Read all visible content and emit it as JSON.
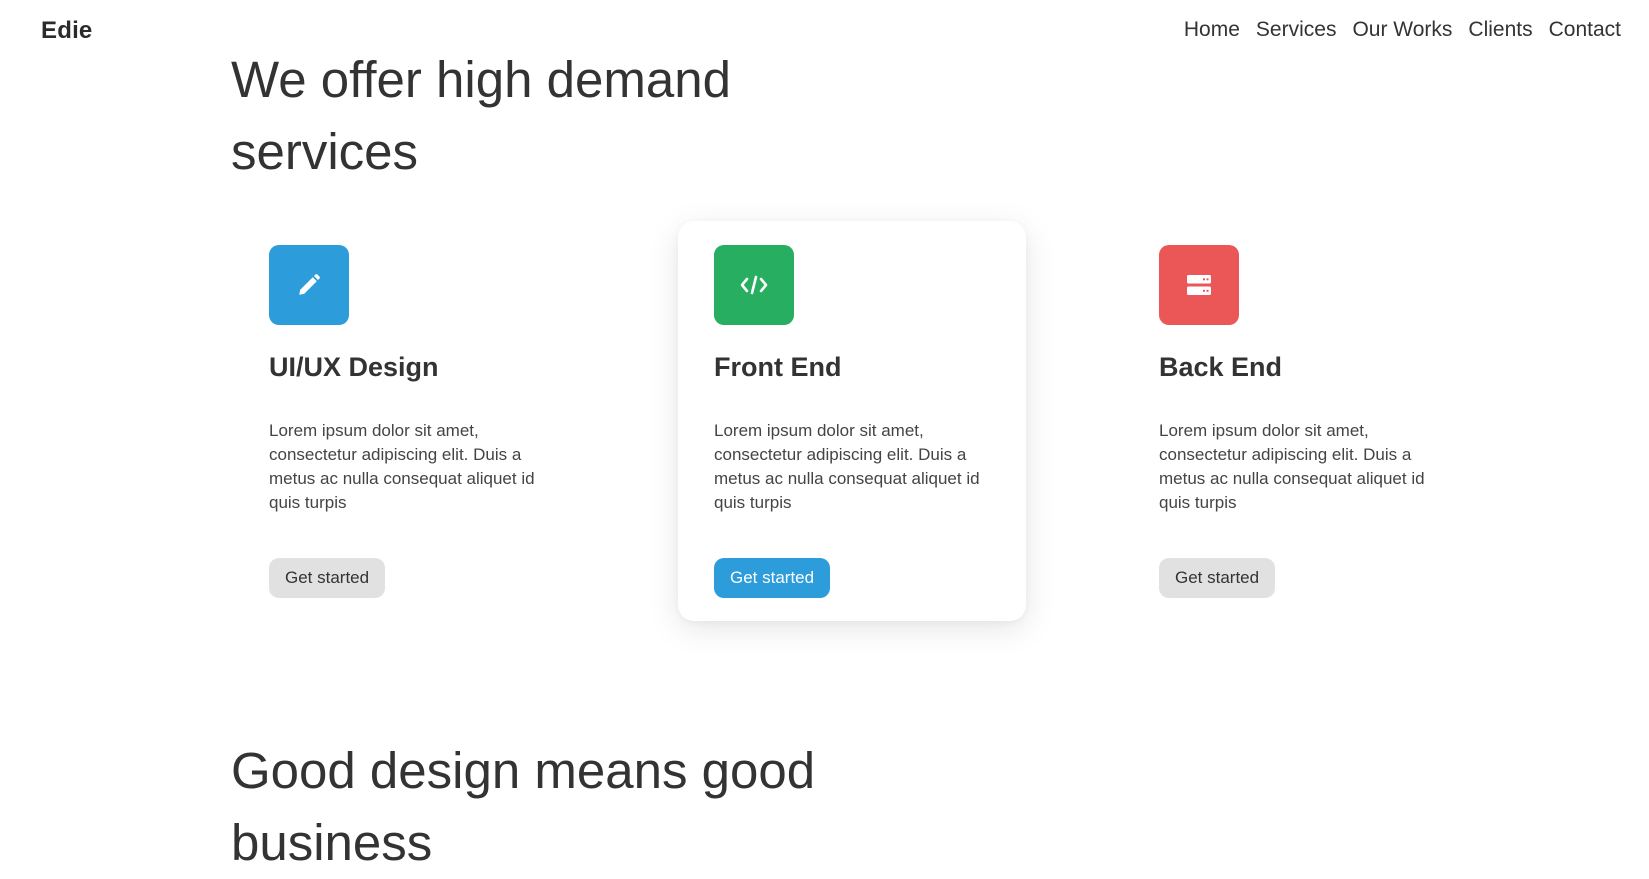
{
  "brand": {
    "name": "Edie"
  },
  "nav": {
    "items": [
      {
        "label": "Home"
      },
      {
        "label": "Services"
      },
      {
        "label": "Our Works"
      },
      {
        "label": "Clients"
      },
      {
        "label": "Contact"
      }
    ]
  },
  "services": {
    "title": "We offer high demand services",
    "cards": [
      {
        "icon": "pencil-icon",
        "color": "#2d9cdb",
        "title": "UI/UX Design",
        "text": "Lorem ipsum dolor sit amet, consectetur adipiscing elit. Duis a metus ac nulla consequat aliquet id quis turpis",
        "button": "Get started"
      },
      {
        "icon": "code-icon",
        "color": "#27ae60",
        "title": "Front End",
        "text": "Lorem ipsum dolor sit amet, consectetur adipiscing elit. Duis a metus ac nulla consequat aliquet id quis turpis",
        "button": "Get started"
      },
      {
        "icon": "server-icon",
        "color": "#eb5757",
        "title": "Back End",
        "text": "Lorem ipsum dolor sit amet, consectetur adipiscing elit. Duis a metus ac nulla consequat aliquet id quis turpis",
        "button": "Get started"
      }
    ]
  },
  "design": {
    "title": "Good design means good business"
  }
}
